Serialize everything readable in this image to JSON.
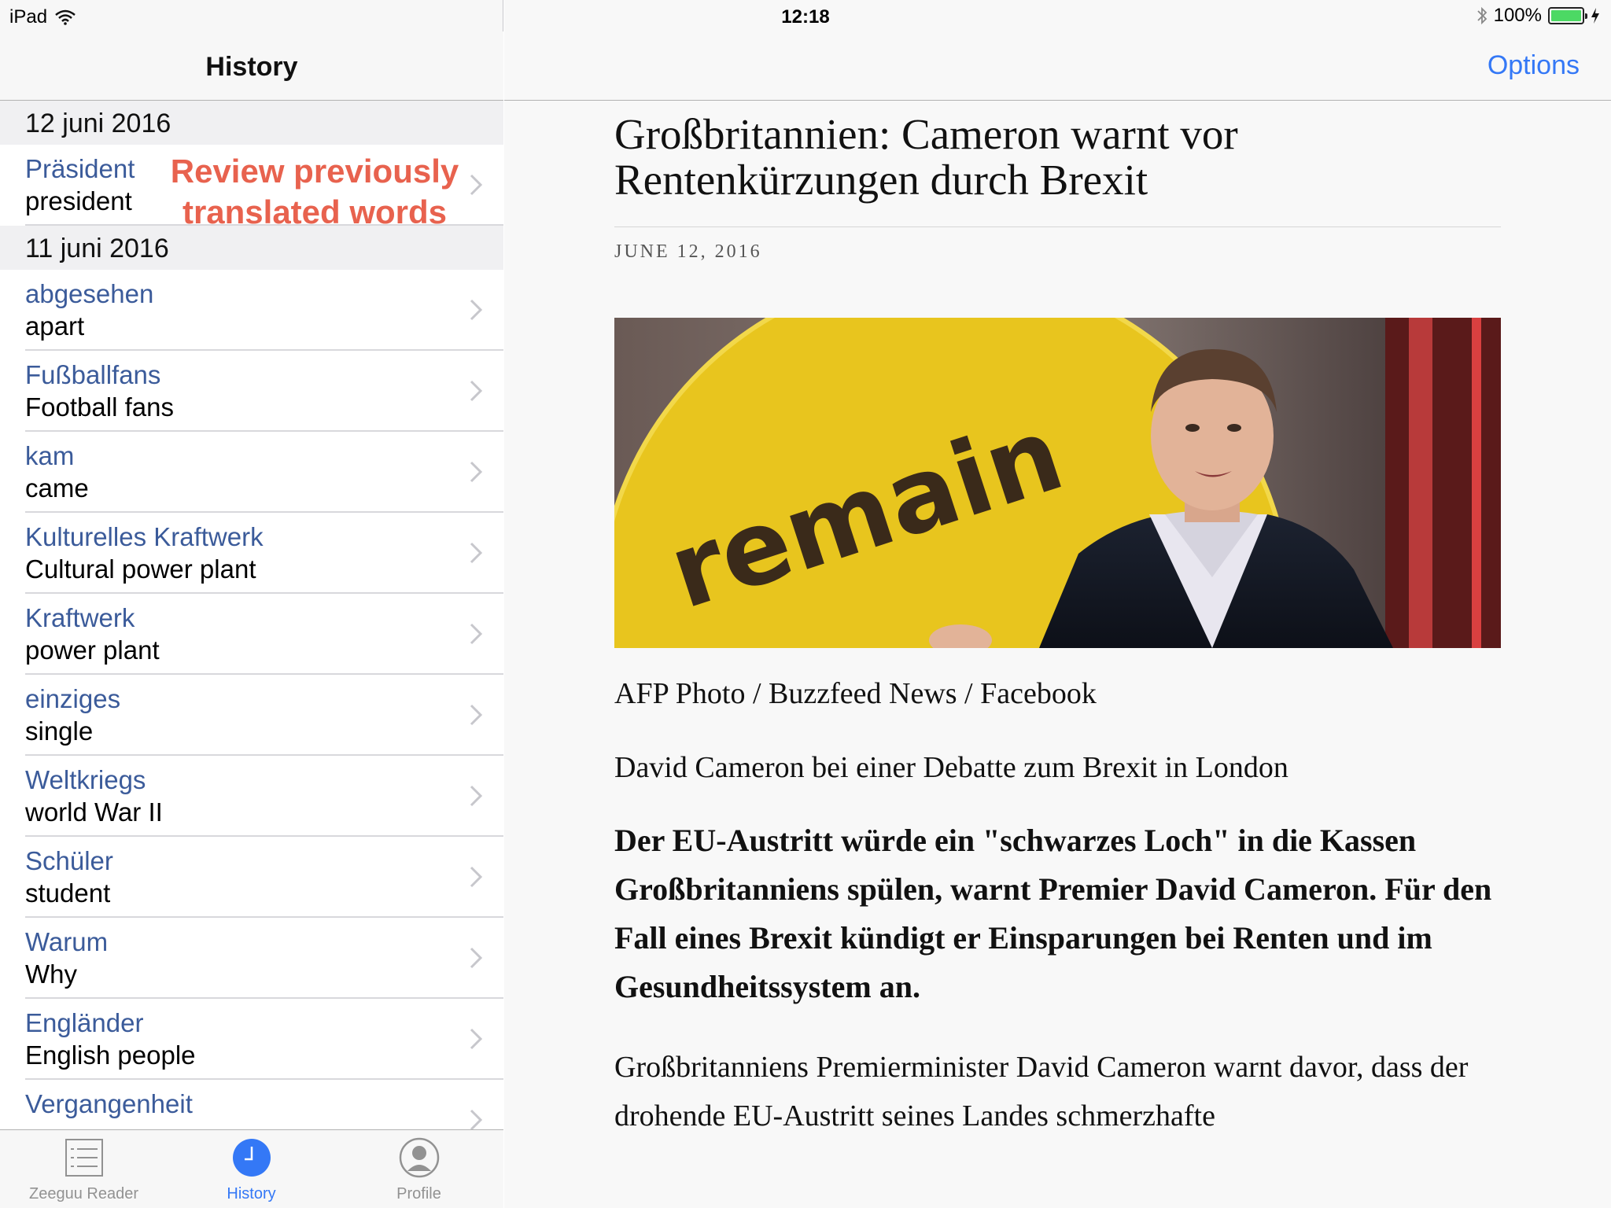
{
  "status_bar": {
    "device": "iPad",
    "time": "12:18",
    "battery": "100%",
    "battery_level": 1.0
  },
  "sidebar": {
    "title": "History",
    "overlay_note": "Review previously translated words",
    "sections": [
      {
        "date": "12 juni 2016",
        "items": [
          {
            "word": "Präsident",
            "translation": "president"
          }
        ]
      },
      {
        "date": "11 juni 2016",
        "items": [
          {
            "word": "abgesehen",
            "translation": "apart"
          },
          {
            "word": "Fußballfans",
            "translation": "Football fans"
          },
          {
            "word": "kam",
            "translation": "came"
          },
          {
            "word": "Kulturelles Kraftwerk",
            "translation": "Cultural power plant"
          },
          {
            "word": "Kraftwerk",
            "translation": "power plant"
          },
          {
            "word": "einziges",
            "translation": "single"
          },
          {
            "word": "Weltkriegs",
            "translation": "world War II"
          },
          {
            "word": "Schüler",
            "translation": "student"
          },
          {
            "word": "Warum",
            "translation": "Why"
          },
          {
            "word": "Engländer",
            "translation": "English people"
          },
          {
            "word": "Vergangenheit",
            "translation": ""
          }
        ]
      }
    ]
  },
  "tab_bar": {
    "tabs": [
      {
        "label": "Zeeguu Reader",
        "icon": "list-icon",
        "active": false
      },
      {
        "label": "History",
        "icon": "clock-icon",
        "active": true
      },
      {
        "label": "Profile",
        "icon": "profile-icon",
        "active": false
      }
    ]
  },
  "header": {
    "options_label": "Options"
  },
  "article": {
    "title": "Großbritannien: Cameron warnt vor Rentenkürzungen durch Brexit",
    "date": "JUNE 12, 2016",
    "image_text": "remain",
    "photo_credit": "AFP Photo / Buzzfeed News / Facebook",
    "caption": "David Cameron bei einer Debatte zum Brexit in London",
    "lead": "Der EU-Austritt würde ein \"schwarzes Loch\" in die Kassen Großbritanniens spülen, warnt Premier David Cameron. Für den Fall eines Brexit kündigt er Einsparungen bei Renten und im Gesundheitssystem an.",
    "body": "Großbritanniens Premierminister David Cameron warnt davor, dass der drohende EU-Austritt seines Landes schmerzhafte"
  },
  "colors": {
    "accent": "#3478f6",
    "word": "#3b5b9a",
    "overlay_note": "#e8624e",
    "battery": "#4cd964"
  }
}
